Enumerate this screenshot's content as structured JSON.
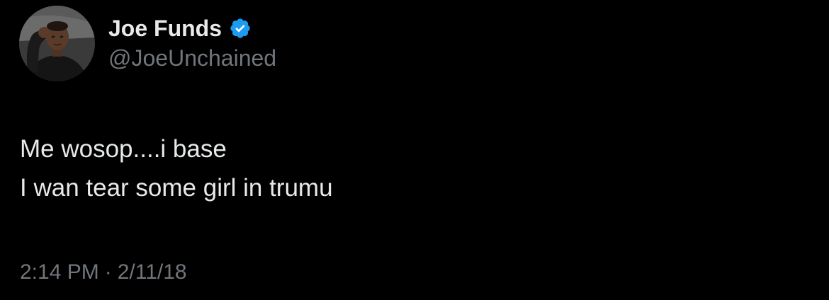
{
  "author": {
    "display_name": "Joe Funds",
    "handle": "@JoeUnchained",
    "verified": true,
    "verified_badge_icon": "verified-badge-icon",
    "verified_color": "#1d9bf0"
  },
  "tweet": {
    "lines": [
      "Me wosop....i base",
      "I wan tear some girl in trumu"
    ],
    "time": "2:14 PM",
    "separator": "·",
    "date": "2/11/18"
  },
  "theme": {
    "background": "#000000",
    "primary_text": "#e7e9ea",
    "secondary_text": "#71767b"
  }
}
